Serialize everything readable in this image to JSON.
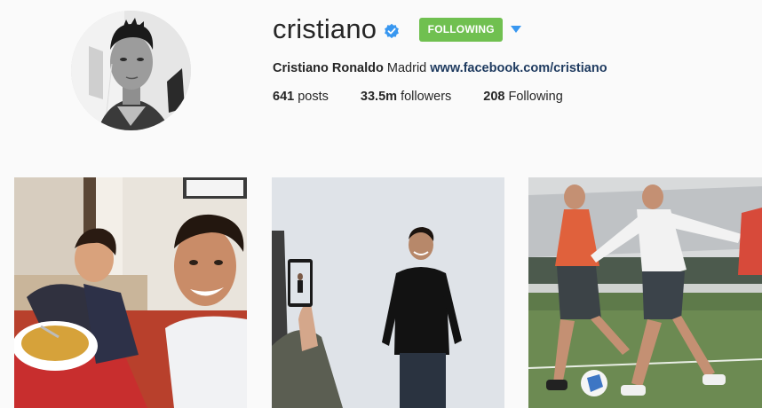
{
  "profile": {
    "username": "cristiano",
    "verified": true,
    "follow_button": "FOLLOWING",
    "full_name": "Cristiano Ronaldo",
    "bio_text": "Madrid",
    "website": "www.facebook.com/cristiano",
    "stats": {
      "posts_count": "641",
      "posts_label": "posts",
      "followers_count": "33.5m",
      "followers_label": "followers",
      "following_count": "208",
      "following_label": "Following"
    }
  },
  "icons": {
    "verified": "verified-badge-icon",
    "dropdown": "triangle-down-icon"
  },
  "colors": {
    "follow_button": "#70c050",
    "verified_badge": "#3897f0",
    "dropdown_arrow": "#3897f0",
    "link": "#1e3a5f",
    "background": "#fafafa"
  }
}
